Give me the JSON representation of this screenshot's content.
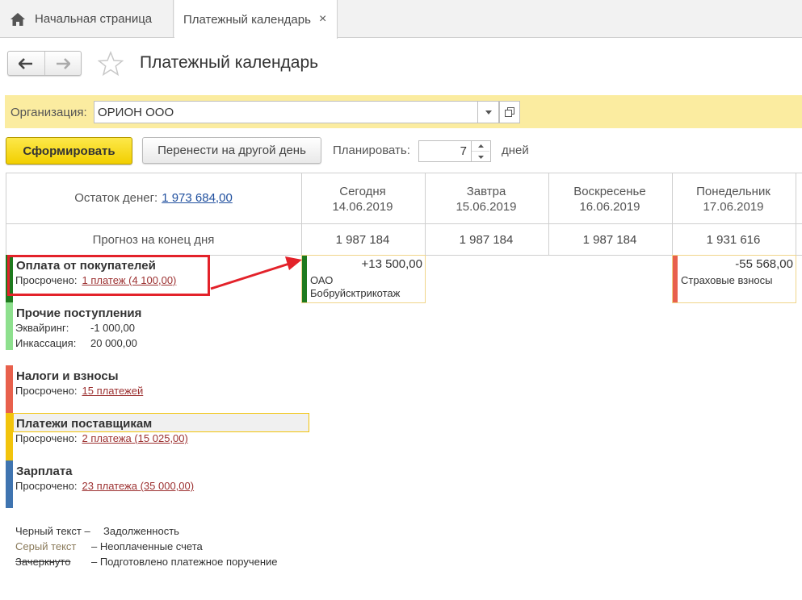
{
  "tabs": {
    "home_label": "Начальная страница",
    "active_label": "Платежный календарь",
    "close_glyph": "×"
  },
  "page": {
    "title": "Платежный календарь"
  },
  "organization": {
    "label": "Организация:",
    "value": "ОРИОН ООО"
  },
  "actions": {
    "generate_label": "Сформировать",
    "move_label": "Перенести на другой день",
    "plan_label": "Планировать:",
    "plan_value": "7",
    "plan_unit": "дней"
  },
  "calendar": {
    "balance_label": "Остаток денег:",
    "balance_value": "1 973 684,00",
    "forecast_label": "Прогноз на конец дня",
    "days": [
      {
        "name": "Сегодня",
        "date": "14.06.2019",
        "forecast": "1 987 184"
      },
      {
        "name": "Завтра",
        "date": "15.06.2019",
        "forecast": "1 987 184"
      },
      {
        "name": "Воскресенье",
        "date": "16.06.2019",
        "forecast": "1 987 184"
      },
      {
        "name": "Понедельник",
        "date": "17.06.2019",
        "forecast": "1 931 616"
      }
    ],
    "categories": [
      {
        "title": "Оплата от покупателей",
        "color": "#1e7a1e",
        "overdue_label": "Просрочено:",
        "overdue_link": "1 платеж (4 100,00)"
      },
      {
        "title": "Прочие поступления",
        "color": "#8ee08e",
        "line1_key": "Эквайринг:",
        "line1_value": "-1 000,00",
        "line2_key": "Инкассация:",
        "line2_value": "20 000,00"
      },
      {
        "title": "Налоги и взносы",
        "color": "#e8604c",
        "overdue_label": "Просрочено:",
        "overdue_link": "15 платежей"
      },
      {
        "title": "Платежи поставщикам",
        "color": "#f2c40c",
        "overdue_label": "Просрочено:",
        "overdue_link": "2 платежа (15 025,00)"
      },
      {
        "title": "Зарплата",
        "color": "#3f74b0",
        "overdue_label": "Просрочено:",
        "overdue_link": "23 платежа (35 000,00)"
      }
    ],
    "entries": [
      {
        "amount": "+13 500,00",
        "line1": "ОАО",
        "line2": "Бобруйсктрикотаж",
        "color": "#1e7a1e"
      },
      {
        "amount": "-55 568,00",
        "line1": "Страховые взносы",
        "color": "#e8604c"
      }
    ]
  },
  "legend": {
    "items": [
      {
        "key": "Черный текст –",
        "value": "Задолженность"
      },
      {
        "key": "Серый текст",
        "value": "–  Неоплаченные счета"
      },
      {
        "key": "Зачеркнуто",
        "value": "–  Подготовлено платежное поручение"
      }
    ]
  }
}
